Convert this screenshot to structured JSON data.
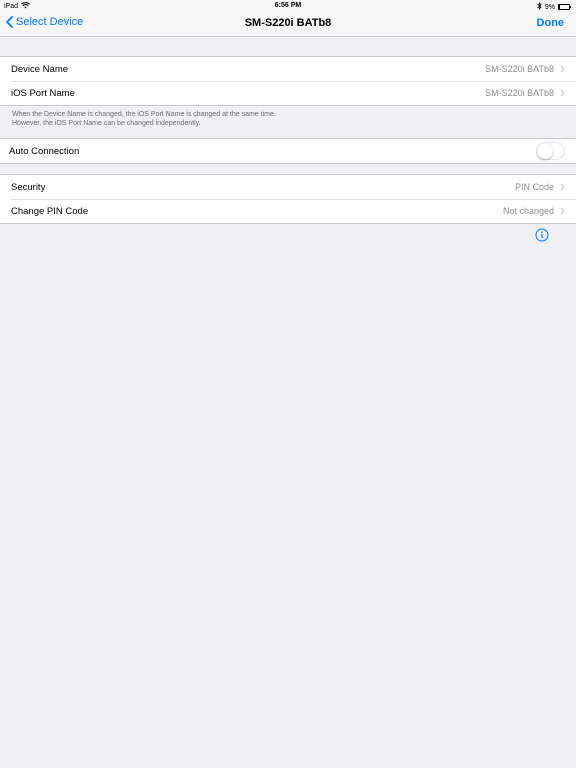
{
  "status_bar": {
    "device": "iPad",
    "time": "6:56 PM",
    "battery": "9%"
  },
  "nav": {
    "back_label": "Select Device",
    "title": "SM-S220i BATb8",
    "done_label": "Done"
  },
  "device_group": {
    "rows": [
      {
        "label": "Device Name",
        "value": "SM-S220i BATb8"
      },
      {
        "label": "iOS Port Name",
        "value": "SM-S220i BATb8"
      }
    ],
    "footer_line1": "When the Device Name is changed, the iOS Port Name is changed at the same time.",
    "footer_line2": "However, the iOS Port Name can be changed independently."
  },
  "auto_connection": {
    "label": "Auto Connection",
    "enabled": false
  },
  "security_group": {
    "rows": [
      {
        "label": "Security",
        "value": "PIN Code"
      },
      {
        "label": "Change PIN Code",
        "value": "Not changed"
      }
    ]
  },
  "colors": {
    "accent": "#007aff",
    "background": "#efeff4",
    "secondary_text": "#8e8e93"
  }
}
